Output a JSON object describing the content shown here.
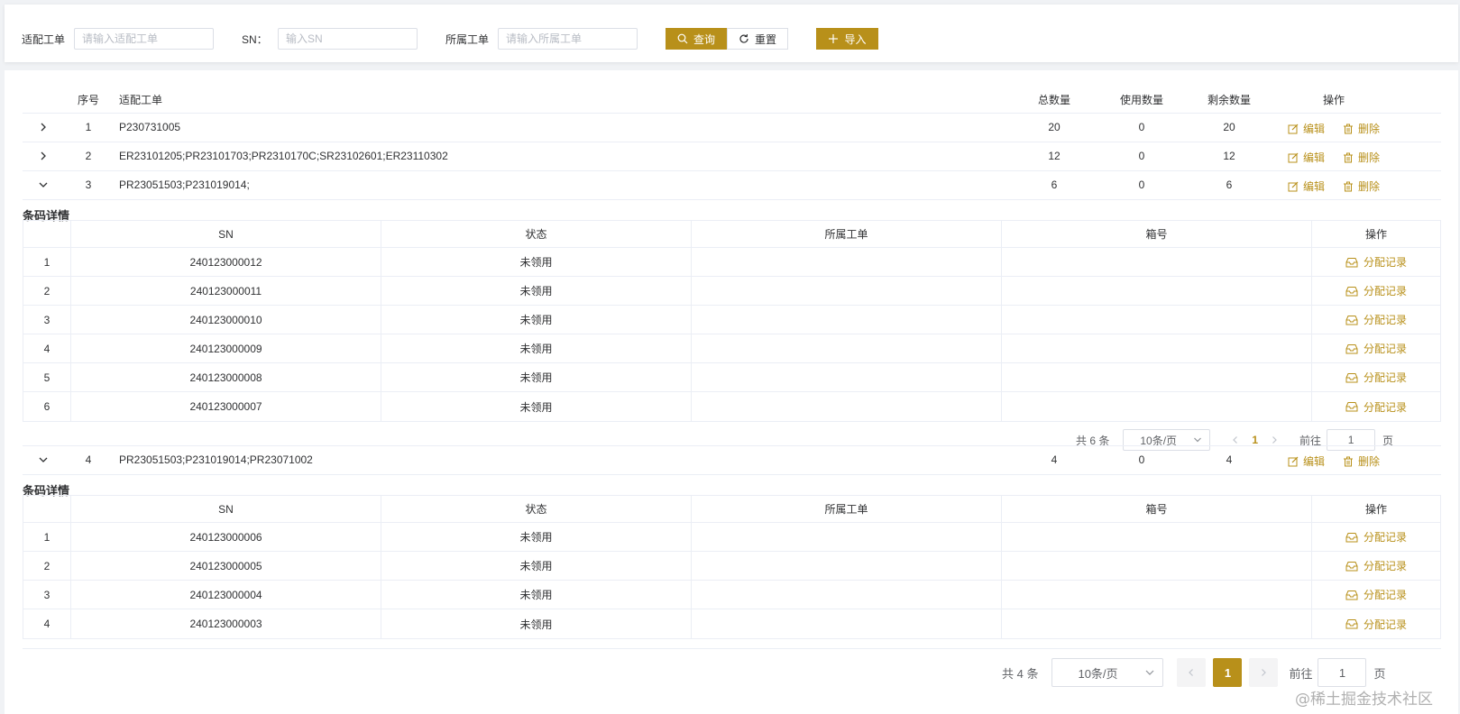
{
  "search": {
    "order_label": "适配工单",
    "order_placeholder": "请输入适配工单",
    "sn_label": "SN：",
    "sn_placeholder": "输入SN",
    "belong_label": "所属工单",
    "belong_placeholder": "请输入所属工单",
    "query_label": "查询",
    "reset_label": "重置",
    "import_label": "导入"
  },
  "table": {
    "headers": {
      "seq": "序号",
      "order": "适配工单",
      "total": "总数量",
      "used": "使用数量",
      "remain": "剩余数量",
      "ops": "操作"
    },
    "edit_label": "编辑",
    "delete_label": "删除",
    "rows": [
      {
        "seq": "1",
        "order": "P230731005",
        "total": "20",
        "used": "0",
        "remain": "20"
      },
      {
        "seq": "2",
        "order": "ER23101205;PR23101703;PR2310170C;SR23102601;ER23110302",
        "total": "12",
        "used": "0",
        "remain": "12"
      },
      {
        "seq": "3",
        "order": "PR23051503;P231019014;",
        "total": "6",
        "used": "0",
        "remain": "6"
      },
      {
        "seq": "4",
        "order": "PR23051503;P231019014;PR23071002",
        "total": "4",
        "used": "0",
        "remain": "4"
      }
    ]
  },
  "detail": {
    "title": "条码详情",
    "headers": {
      "sn": "SN",
      "status": "状态",
      "belong": "所属工单",
      "box": "箱号",
      "ops": "操作"
    },
    "alloc_label": "分配记录",
    "groups": [
      {
        "rows": [
          {
            "idx": "1",
            "sn": "240123000012",
            "status": "未领用",
            "belong": "",
            "box": ""
          },
          {
            "idx": "2",
            "sn": "240123000011",
            "status": "未领用",
            "belong": "",
            "box": ""
          },
          {
            "idx": "3",
            "sn": "240123000010",
            "status": "未领用",
            "belong": "",
            "box": ""
          },
          {
            "idx": "4",
            "sn": "240123000009",
            "status": "未领用",
            "belong": "",
            "box": ""
          },
          {
            "idx": "5",
            "sn": "240123000008",
            "status": "未领用",
            "belong": "",
            "box": ""
          },
          {
            "idx": "6",
            "sn": "240123000007",
            "status": "未领用",
            "belong": "",
            "box": ""
          }
        ],
        "pager": {
          "total": "共 6 条",
          "size": "10条/页",
          "page": "1",
          "goto": "前往",
          "goto_value": "1",
          "unit": "页"
        }
      },
      {
        "rows": [
          {
            "idx": "1",
            "sn": "240123000006",
            "status": "未领用",
            "belong": "",
            "box": ""
          },
          {
            "idx": "2",
            "sn": "240123000005",
            "status": "未领用",
            "belong": "",
            "box": ""
          },
          {
            "idx": "3",
            "sn": "240123000004",
            "status": "未领用",
            "belong": "",
            "box": ""
          },
          {
            "idx": "4",
            "sn": "240123000003",
            "status": "未领用",
            "belong": "",
            "box": ""
          }
        ]
      }
    ]
  },
  "pager_main": {
    "total": "共 4 条",
    "size": "10条/页",
    "page": "1",
    "goto": "前往",
    "goto_value": "1",
    "unit": "页"
  },
  "watermark": "@稀土掘金技术社区",
  "colors": {
    "accent": "#b8901a",
    "border": "#ebeef5"
  }
}
